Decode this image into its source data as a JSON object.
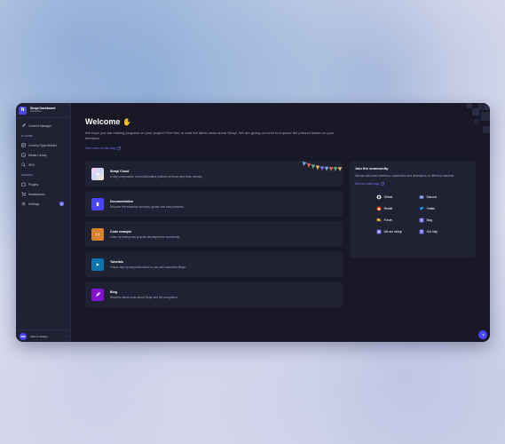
{
  "sidebar": {
    "brand_logo": "N",
    "brand_name": "Strapi Dashboard",
    "workspace": "Workplace",
    "content_manager": "Content Manager",
    "plugins_section": "PLUGINS",
    "content_type_builder": "Content-Type Builder",
    "media_library": "Media Library",
    "seo": "SEO",
    "general_section": "GENERAL",
    "plugins": "Plugins",
    "marketplace": "Marketplace",
    "settings": "Settings",
    "settings_badge": "1",
    "user_initials": "MM",
    "user_name": "Mabrur Maliga",
    "user_chevron": "›"
  },
  "main": {
    "title": "Welcome",
    "wave_icon": "waving-hand-icon",
    "subtitle": "We hope you are making progress on your project! Feel free to read the latest news about Strapi. We are giving our best to improve the product based on your feedback.",
    "blog_link": "See more on the blog"
  },
  "cards": [
    {
      "title": "Strapi Cloud",
      "desc": "A fully composable, and collaborative platform to boost your team velocity.",
      "icon": "cloud-gradient-icon",
      "color": "#e8e0f7"
    },
    {
      "title": "Documentation",
      "desc": "Discover the essential concepts, guides and best practices.",
      "icon": "book-icon",
      "color": "#4945ff"
    },
    {
      "title": "Code example",
      "desc": "Learn by testing real projects developed the community.",
      "icon": "code-icon",
      "color": "#d9822f"
    },
    {
      "title": "Tutorials",
      "desc": "Follow step-by-step instructions to use and customize Strapi.",
      "icon": "play-icon",
      "color": "#0c75af"
    },
    {
      "title": "Blog",
      "desc": "Read the latest news about Strapi and the ecosystem.",
      "icon": "feather-icon",
      "color": "#8312d1"
    }
  ],
  "community": {
    "title": "Join the community",
    "desc": "Discuss with team members, contributors and developers on different channels.",
    "link": "See our road map",
    "links": [
      {
        "label": "Github",
        "icon": "github-icon",
        "color": "#ffffff"
      },
      {
        "label": "Discord",
        "icon": "discord-icon",
        "color": "#7289da"
      },
      {
        "label": "Reddit",
        "icon": "reddit-icon",
        "color": "#ff4500"
      },
      {
        "label": "Twitter",
        "icon": "twitter-icon",
        "color": "#1da1f2"
      },
      {
        "label": "Forum",
        "icon": "forum-icon",
        "color": "#f5c04a"
      },
      {
        "label": "Blog",
        "icon": "blog-icon",
        "color": "#7b79ff"
      },
      {
        "label": "We are hiring!",
        "icon": "hiring-icon",
        "color": "#7b79ff"
      },
      {
        "label": "Get help",
        "icon": "help-icon",
        "color": "#7b79ff"
      }
    ]
  },
  "colors": {
    "accent": "#4945ff",
    "link": "#7b79ff",
    "surface": "#212134",
    "background": "#181826"
  }
}
